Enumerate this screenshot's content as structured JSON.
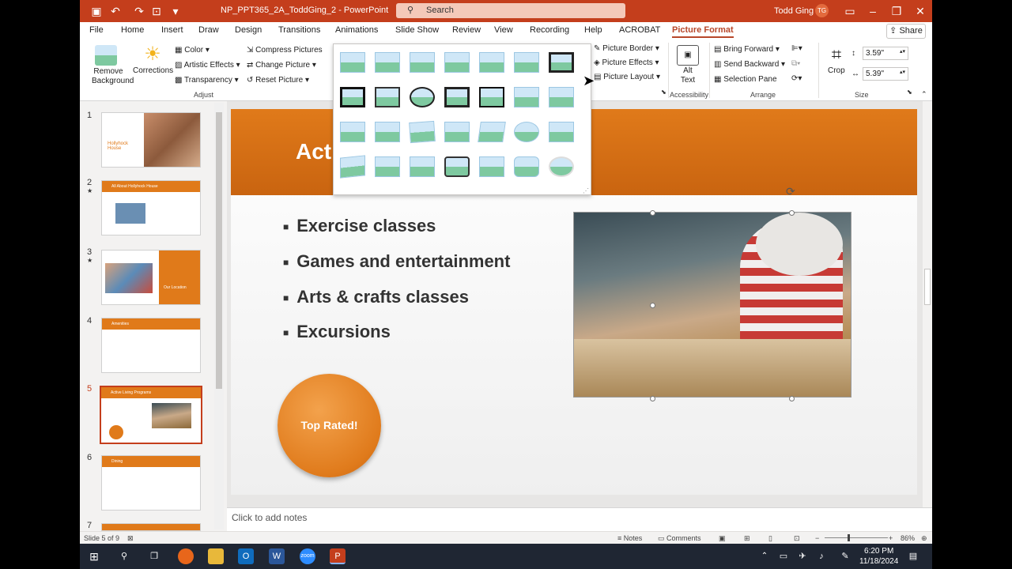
{
  "window": {
    "doc_title": "NP_PPT365_2A_ToddGing_2  -  PowerPoint",
    "search_placeholder": "Search",
    "user_name": "Todd Ging",
    "user_initials": "TG"
  },
  "tabs": [
    "File",
    "Home",
    "Insert",
    "Draw",
    "Design",
    "Transitions",
    "Animations",
    "Slide Show",
    "Review",
    "View",
    "Recording",
    "Help",
    "ACROBAT",
    "Picture Format"
  ],
  "share_label": "Share",
  "ribbon": {
    "remove_bg": "Remove Background",
    "corrections": "Corrections",
    "color": "Color",
    "artistic": "Artistic Effects",
    "transparency": "Transparency",
    "compress": "Compress Pictures",
    "change": "Change Picture",
    "reset": "Reset Picture",
    "adjust_group": "Adjust",
    "border": "Picture Border",
    "effects": "Picture Effects",
    "layout": "Picture Layout",
    "alt_text": "Alt Text",
    "accessibility_group": "Accessibility",
    "bring_forward": "Bring Forward",
    "send_backward": "Send Backward",
    "selection_pane": "Selection Pane",
    "arrange_group": "Arrange",
    "crop": "Crop",
    "height": "3.59\"",
    "width": "5.39\"",
    "size_group": "Size"
  },
  "slides": {
    "numbers": [
      "1",
      "2",
      "3",
      "4",
      "5",
      "6",
      "7"
    ],
    "thumb1_title": "Hollyhock House",
    "thumb2_title": "All About Hollyhock House",
    "thumb3_title": "Our Location",
    "thumb4_title": "Amenities",
    "thumb5_title": "Active Living Programs",
    "thumb6_title": "Dining"
  },
  "slide": {
    "title": "Act",
    "bullets": [
      "Exercise classes",
      "Games and entertainment",
      "Arts & crafts classes",
      "Excursions"
    ],
    "badge": "Top Rated!"
  },
  "notes_placeholder": "Click to add notes",
  "status": {
    "slide_info": "Slide 5 of 9",
    "notes": "Notes",
    "comments": "Comments",
    "zoom": "86%"
  },
  "taskbar": {
    "time": "6:20 PM",
    "date": "11/18/2024"
  },
  "colors": {
    "accent": "#c43e1c",
    "slide_orange": "#e07a1a"
  }
}
